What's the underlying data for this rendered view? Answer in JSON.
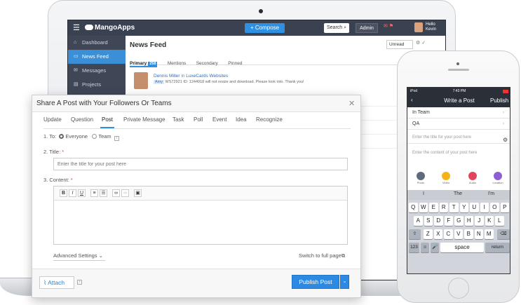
{
  "laptop": {
    "app": {
      "logo": "MangoApps",
      "compose": "+ Compose",
      "search": "Search",
      "admin": "Admin",
      "hello": "Hello",
      "user": "Kevin",
      "sidebar": [
        {
          "label": "Dashboard",
          "icon": "home-icon"
        },
        {
          "label": "News Feed",
          "icon": "feed-icon",
          "active": true
        },
        {
          "label": "Messages",
          "icon": "messages-icon"
        },
        {
          "label": "Projects",
          "icon": "projects-icon"
        }
      ],
      "feed": {
        "title": "News Feed",
        "filter": "Unread",
        "tabs": {
          "primary": "Primary",
          "primary_count": "258",
          "mentions": "Mentions",
          "secondary": "Secondary",
          "pinned": "Pinned"
        },
        "post": {
          "author": "Dennis Miller",
          "in": "in",
          "group": "LuxeCards Websites",
          "tag": "Amy",
          "text": "WS72921 ID: 1244918 will not resize and download. Please look into. Thank you!"
        }
      }
    }
  },
  "modal": {
    "title": "Share A Post with Your Followers Or Teams",
    "tabs": [
      "Update",
      "Question",
      "Post",
      "Private Message",
      "Task",
      "Poll",
      "Event",
      "Idea",
      "Recognize"
    ],
    "active_tab": "Post",
    "to_label": "1.  To:",
    "to_everyone": "Everyone",
    "to_team": "Team",
    "title_label": "2.  Title:",
    "title_placeholder": "Enter the title for your post here",
    "content_label": "3.  Content:",
    "toolbar": {
      "bold": "B",
      "italic": "I",
      "underline": "U"
    },
    "advanced": "Advanced Settings",
    "switch": "Switch to full page",
    "attach": "Attach",
    "publish": "Publish Post"
  },
  "phone": {
    "status_time": "7:43 PM",
    "status_carrier": "iPod",
    "nav_title": "Write a Post",
    "nav_publish": "Publish",
    "rows": [
      "In Team",
      "QA"
    ],
    "title_placeholder": "Enter the title for your post here",
    "content_placeholder": "Enter the content of your post here",
    "tools": [
      {
        "label": "Photo",
        "color": "#5f6b7a"
      },
      {
        "label": "Video",
        "color": "#f5b21b"
      },
      {
        "label": "Audio",
        "color": "#e2455a"
      },
      {
        "label": "Location",
        "color": "#8d5fd3"
      }
    ],
    "suggestions": [
      "I",
      "The",
      "I'm"
    ],
    "keys_row1": [
      "Q",
      "W",
      "E",
      "R",
      "T",
      "Y",
      "U",
      "I",
      "O",
      "P"
    ],
    "keys_row2": [
      "A",
      "S",
      "D",
      "F",
      "G",
      "H",
      "J",
      "K",
      "L"
    ],
    "keys_row3": [
      "Z",
      "X",
      "C",
      "V",
      "B",
      "N",
      "M"
    ],
    "key_123": "123",
    "key_space": "space",
    "key_return": "return"
  }
}
